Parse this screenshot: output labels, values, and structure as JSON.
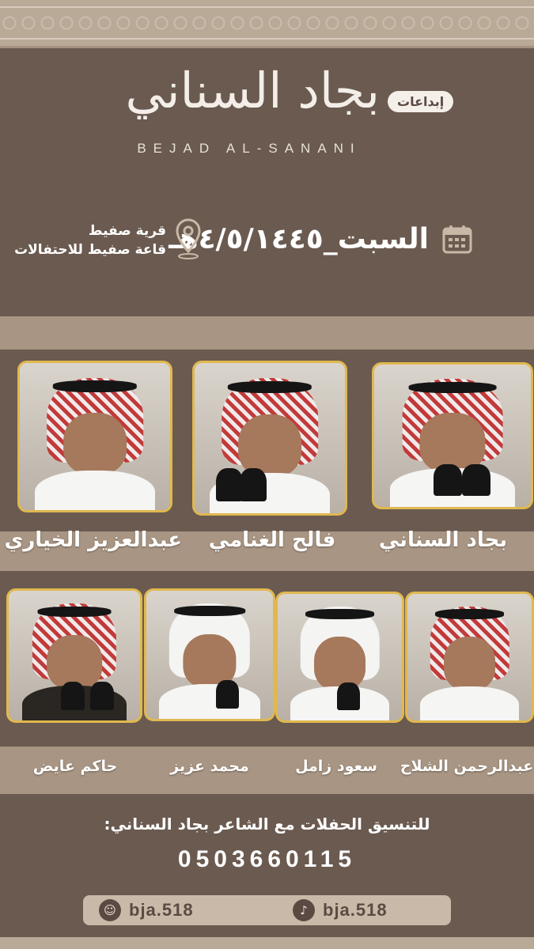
{
  "header": {
    "logo_arabic": "بجاد السناني",
    "logo_english": "BEJAD AL-SANANI",
    "badge": "إبداعات"
  },
  "event": {
    "date": "السبت_٤/٥/١٤٤٥هـ",
    "location_line1": "قرية صفيط",
    "location_line2": "قاعة صفيط للاحتفالات"
  },
  "poets_row1": [
    {
      "name": "بجاد السناني"
    },
    {
      "name": "فالح الغنامي"
    },
    {
      "name": "عبدالعزيز الخياري"
    }
  ],
  "poets_row2": [
    {
      "name": "عبدالرحمن الشلاح"
    },
    {
      "name": "سعود زامل"
    },
    {
      "name": "محمد عزيز"
    },
    {
      "name": "حاكم عايض"
    }
  ],
  "contact": {
    "label": "للتنسيق  الحفلات مع الشاعر بجاد السناني:",
    "phone": "0503660115"
  },
  "social": [
    {
      "icon": "tiktok-icon",
      "handle": "bja.518"
    },
    {
      "icon": "snapchat-icon",
      "handle": "bja.518"
    }
  ],
  "colors": {
    "background": "#6a5a50",
    "band": "#a89583",
    "frame": "#e0b84f"
  }
}
